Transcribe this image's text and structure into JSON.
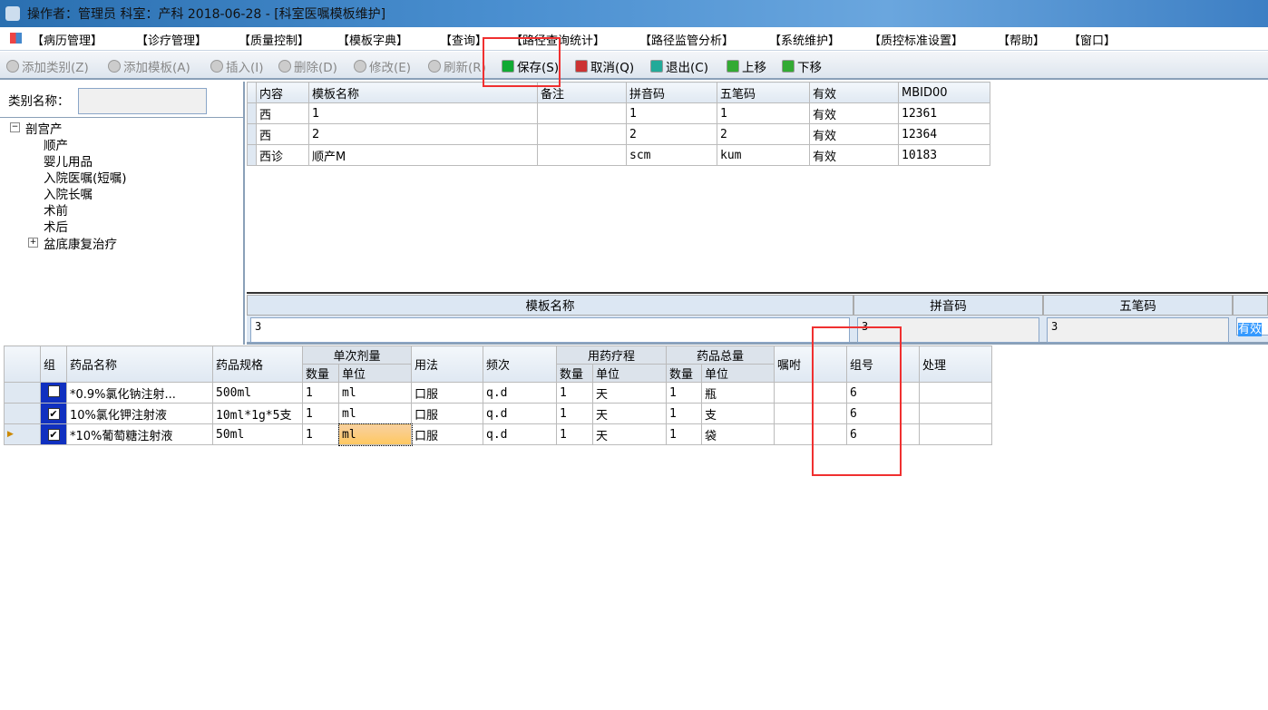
{
  "window": {
    "title": "操作者：管理员  科室：产科  2018-06-28 - [科室医嘱模板维护]"
  },
  "menu": [
    "【病历管理】",
    "【诊疗管理】",
    "【质量控制】",
    "【模板字典】",
    "【查询】",
    "【路径查询统计】",
    "【路径监管分析】",
    "【系统维护】",
    "【质控标准设置】",
    "【帮助】",
    "【窗口】"
  ],
  "toolbar": [
    {
      "label": "添加类别(Z)",
      "icon": "add-icon",
      "enabled": false
    },
    {
      "label": "添加模板(A)",
      "icon": "add-icon",
      "enabled": false
    },
    {
      "label": "插入(I)",
      "icon": "insert-icon",
      "enabled": false
    },
    {
      "label": "删除(D)",
      "icon": "delete-icon",
      "enabled": false
    },
    {
      "label": "修改(E)",
      "icon": "edit-icon",
      "enabled": false
    },
    {
      "label": "刷新(R)",
      "icon": "refresh-icon",
      "enabled": false
    },
    {
      "label": "保存(S)",
      "icon": "save-icon",
      "enabled": true
    },
    {
      "label": "取消(Q)",
      "icon": "undo-icon",
      "enabled": true
    },
    {
      "label": "退出(C)",
      "icon": "exit-icon",
      "enabled": true
    },
    {
      "label": "上移",
      "icon": "arrow-up-icon",
      "enabled": true
    },
    {
      "label": "下移",
      "icon": "arrow-down-icon",
      "enabled": true
    }
  ],
  "category": {
    "label": "类别名称：",
    "value": ""
  },
  "tree": {
    "root": "剖宫产",
    "children": [
      "顺产",
      "婴儿用品",
      "入院医嘱(短嘱)",
      "入院长嘱",
      "术前",
      "术后"
    ],
    "collapsed": "盆底康复治疗"
  },
  "templates": {
    "columns": [
      "内容",
      "模板名称",
      "备注",
      "拼音码",
      "五笔码",
      "有效",
      "MBID00"
    ],
    "rows": [
      [
        "西",
        "1",
        "",
        "1",
        "1",
        "有效",
        "12361"
      ],
      [
        "西",
        "2",
        "",
        "2",
        "2",
        "有效",
        "12364"
      ],
      [
        "西诊",
        "顺产M",
        "",
        "scm",
        "kum",
        "有效",
        "10183"
      ]
    ]
  },
  "editor": {
    "labels": [
      "模板名称",
      "拼音码",
      "五笔码"
    ],
    "name": "3",
    "pinyin": "3",
    "wubi": "3",
    "valid": "有效"
  },
  "drugs": {
    "headers": {
      "group": "组",
      "name": "药品名称",
      "spec": "药品规格",
      "dose": "单次剂量",
      "usage": "用法",
      "freq": "频次",
      "course": "用药疗程",
      "total": "药品总量",
      "qty": "数量",
      "unit": "单位",
      "advice": "嘱咐",
      "groupno": "组号",
      "handle": "处理"
    },
    "rows": [
      {
        "checked": false,
        "name": "*0.9%氯化钠注射...",
        "spec": "500ml",
        "dq": "1",
        "du": "ml",
        "usage": "口服",
        "freq": "q.d",
        "cq": "1",
        "cu": "天",
        "tq": "1",
        "tu": "瓶",
        "advice": "",
        "groupno": "6",
        "handle": ""
      },
      {
        "checked": true,
        "name": "10%氯化钾注射液",
        "spec": "10ml*1g*5支",
        "dq": "1",
        "du": "ml",
        "usage": "口服",
        "freq": "q.d",
        "cq": "1",
        "cu": "天",
        "tq": "1",
        "tu": "支",
        "advice": "",
        "groupno": "6",
        "handle": ""
      },
      {
        "checked": true,
        "name": "*10%葡萄糖注射液",
        "spec": "50ml",
        "dq": "1",
        "du": "ml",
        "usage": "口服",
        "freq": "q.d",
        "cq": "1",
        "cu": "天",
        "tq": "1",
        "tu": "袋",
        "advice": "",
        "groupno": "6",
        "handle": "",
        "current": true
      }
    ]
  },
  "colors": {
    "highlight": "#f03030",
    "selection": "#3399ff",
    "active_cell": "#ffd080"
  }
}
